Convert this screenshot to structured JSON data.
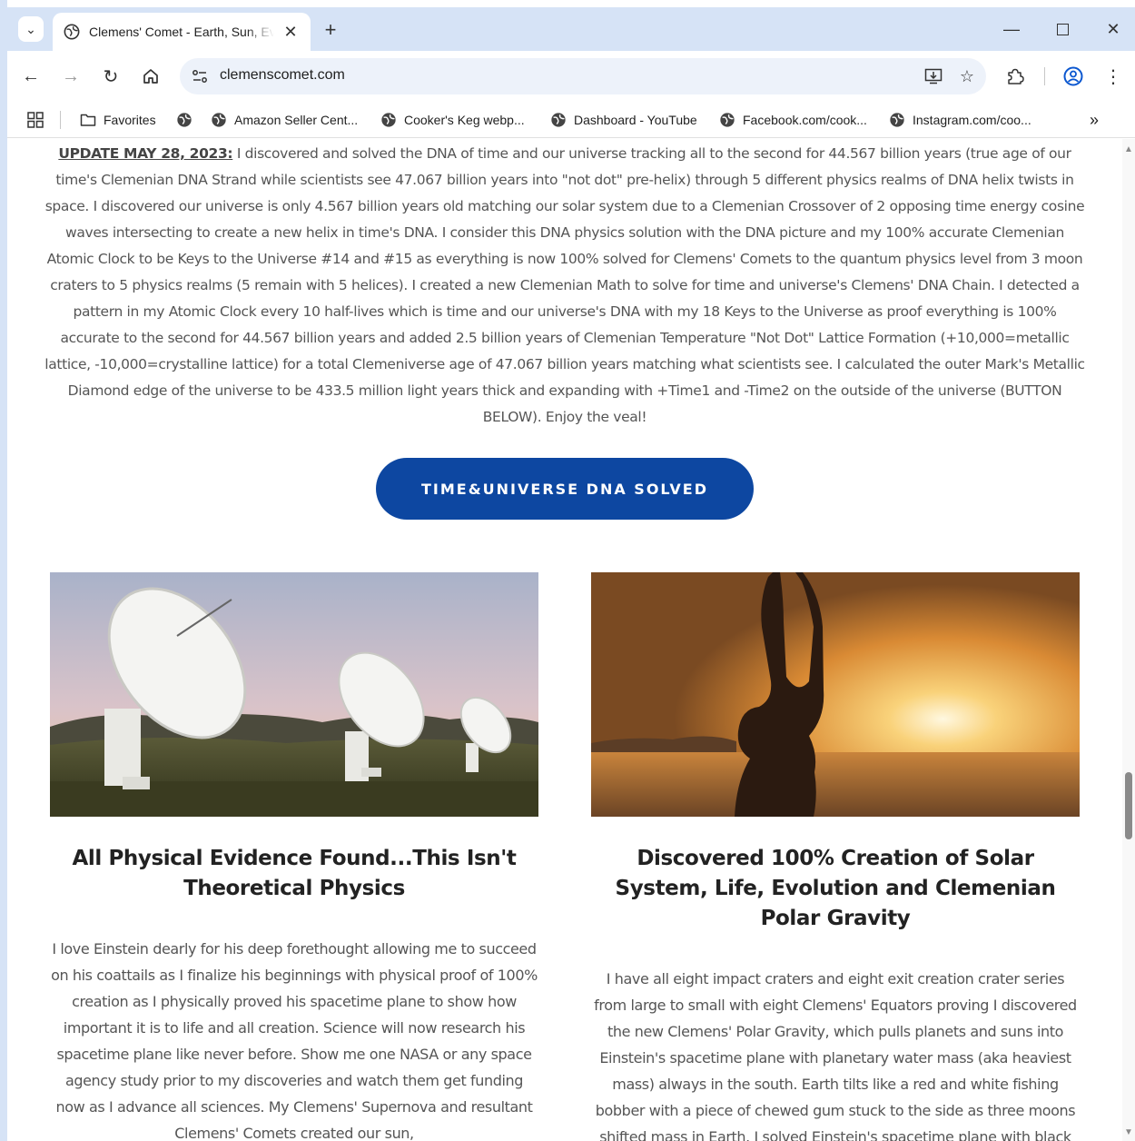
{
  "browser": {
    "tab_title": "Clemens' Comet - Earth, Sun, Evolution",
    "url": "clemenscomet.com",
    "bookmarks": [
      "Favorites",
      "Amazon Seller Cent...",
      "Cooker's Keg webp...",
      "Dashboard - YouTube",
      "Facebook.com/cook...",
      "Instagram.com/coo..."
    ]
  },
  "page": {
    "update_label": "UPDATE MAY 28, 2023:",
    "update_text": " I discovered and solved the DNA of time and our universe tracking all to the second for 44.567 billion years (true age of our time's Clemenian DNA Strand while scientists see 47.067 billion years into \"not dot\" pre-helix) through 5 different physics realms of DNA helix twists in space. I discovered our universe is only 4.567 billion years old matching our solar system due to a Clemenian Crossover of 2 opposing time energy cosine waves intersecting to create a new helix in time's DNA. I consider this DNA physics solution with the DNA picture and my 100% accurate Clemenian Atomic Clock to be Keys to the Universe #14 and #15 as everything is now 100% solved for Clemens' Comets to the quantum physics level from 3 moon craters to 5 physics realms (5 remain with 5 helices). I created a new Clemenian Math to solve for time and universe's Clemens' DNA Chain. I detected a pattern in my Atomic Clock every 10 half-lives which is time and our universe's DNA with my 18 Keys to the Universe as proof everything is 100% accurate to the second for 44.567 billion years and added 2.5 billion years of Clemenian Temperature \"Not Dot\" Lattice Formation (+10,000=metallic lattice, -10,000=crystalline lattice) for a total Clemeniverse age of 47.067 billion years matching what scientists see. I calculated the outer Mark's Metallic Diamond edge of the universe to be 433.5 million light years thick and expanding with +Time1 and -Time2 on the outside of the universe (BUTTON BELOW). Enjoy the veal!",
    "cta_label": "TIME&UNIVERSE DNA SOLVED",
    "cards": [
      {
        "title": "All Physical Evidence Found...This Isn't Theoretical Physics",
        "body": "I love Einstein dearly for his deep forethought allowing me to succeed on his coattails as I finalize his beginnings with physical proof of 100% creation as I physically proved his spacetime plane to show how important it is to life and all creation.  Science will now research his spacetime plane like never before.  Show me one NASA or any space agency study prior to my discoveries and watch them get funding now as I advance all sciences.  My Clemens' Supernova and resultant Clemens' Comets created our sun,"
      },
      {
        "title": "Discovered 100% Creation of Solar System, Life, Evolution and Clemenian Polar Gravity",
        "body": "I have all eight impact craters and eight exit creation crater series from large to small with eight Clemens' Equators proving I discovered the new Clemens' Polar Gravity, which pulls planets and suns into Einstein's spacetime plane with planetary water mass (aka heaviest mass) always in the south. Earth tilts like a red and white fishing bobber with a piece of chewed gum stuck to the side as three moons shifted mass in Earth. I solved Einstein's spacetime plane with black (-) and white (+) holes, and white (+)"
      }
    ]
  }
}
